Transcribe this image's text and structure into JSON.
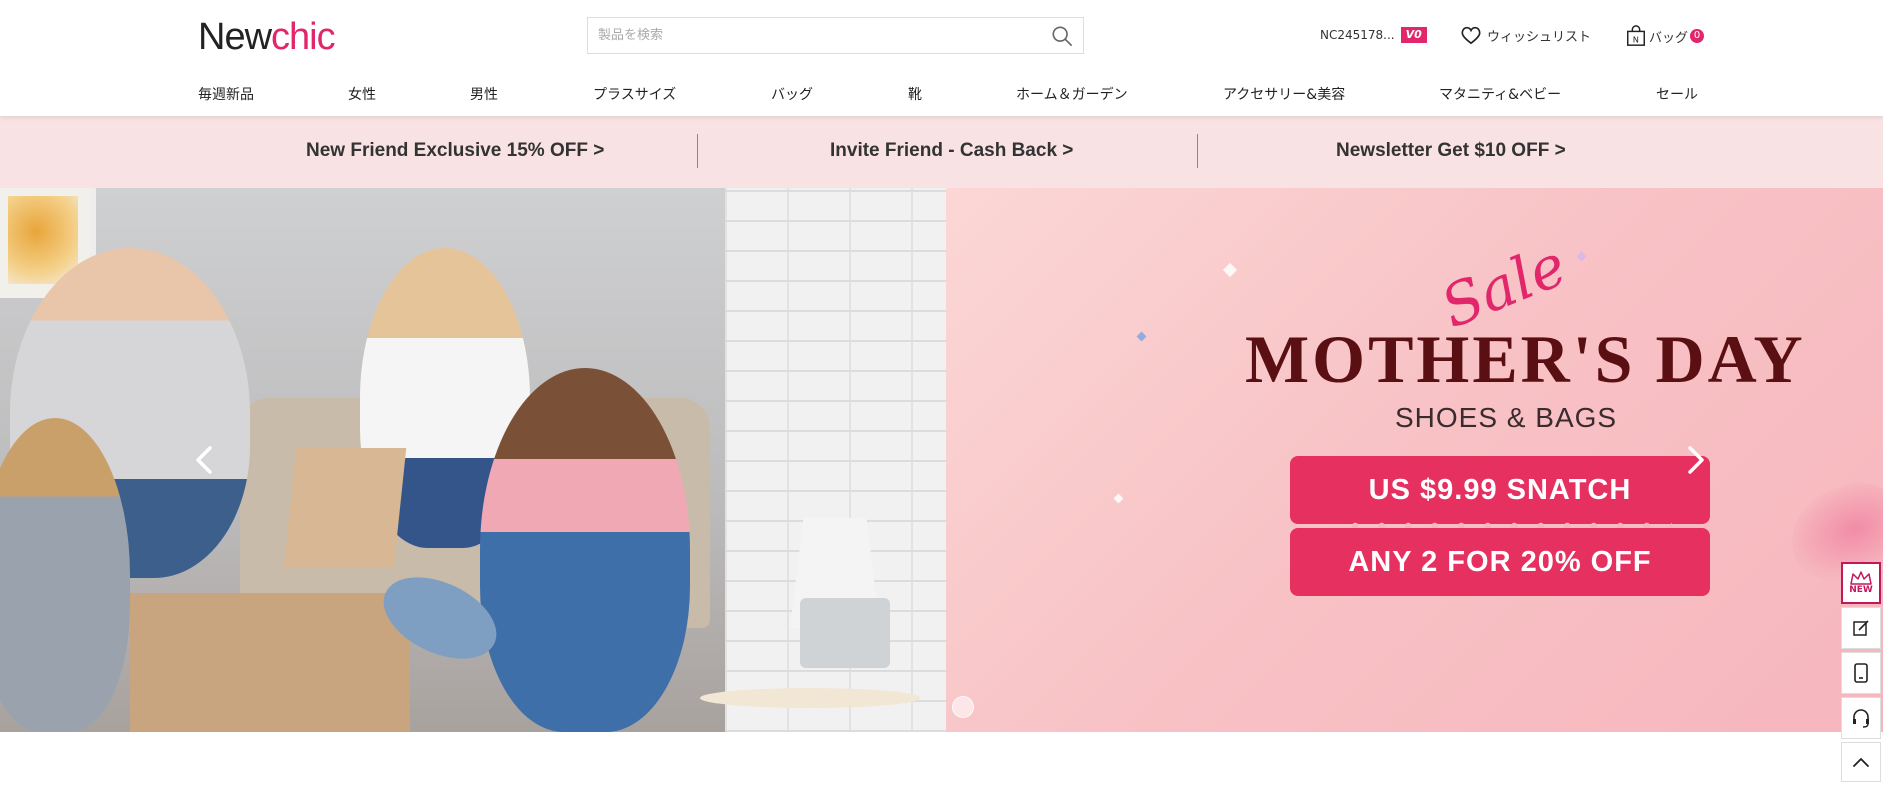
{
  "header": {
    "logo": {
      "part1": "New",
      "part2": "chic"
    },
    "search": {
      "placeholder": "製品を検索",
      "icon": "search-icon"
    },
    "account": {
      "id": "NC245178...",
      "vip_badge": "V0"
    },
    "wishlist": {
      "label": "ウィッシュリスト",
      "icon": "heart-icon"
    },
    "bag": {
      "label": "バッグ",
      "count": "0",
      "icon": "bag-icon"
    }
  },
  "nav": {
    "items": [
      {
        "label": "毎週新品"
      },
      {
        "label": "女性"
      },
      {
        "label": "男性"
      },
      {
        "label": "プラスサイズ"
      },
      {
        "label": "バッグ"
      },
      {
        "label": "靴"
      },
      {
        "label": "ホーム＆ガーデン"
      },
      {
        "label": "アクセサリー&美容"
      },
      {
        "label": "マタニティ&ベビー"
      },
      {
        "label": "セール"
      }
    ]
  },
  "promo": {
    "items": [
      {
        "label": "New Friend Exclusive 15% OFF >"
      },
      {
        "label": "Invite Friend - Cash Back >"
      },
      {
        "label": "Newsletter Get $10 OFF >"
      }
    ]
  },
  "banner": {
    "sale_script": "Sale",
    "title": "MOTHER'S DAY",
    "subtitle": "SHOES & BAGS",
    "offer1": "US $9.99 SNATCH",
    "offer2": "ANY 2 FOR 20% OFF",
    "prev_icon": "chevron-left-icon",
    "next_icon": "chevron-right-icon"
  },
  "sidebar": {
    "new_badge": "NEW",
    "items": [
      "edit-icon",
      "tablet-icon",
      "headset-icon",
      "chevron-up-icon"
    ]
  },
  "colors": {
    "brand": "#e2266b",
    "promo_bg": "#f8e2e4",
    "button": "#e53060",
    "title": "#5a0f13"
  }
}
